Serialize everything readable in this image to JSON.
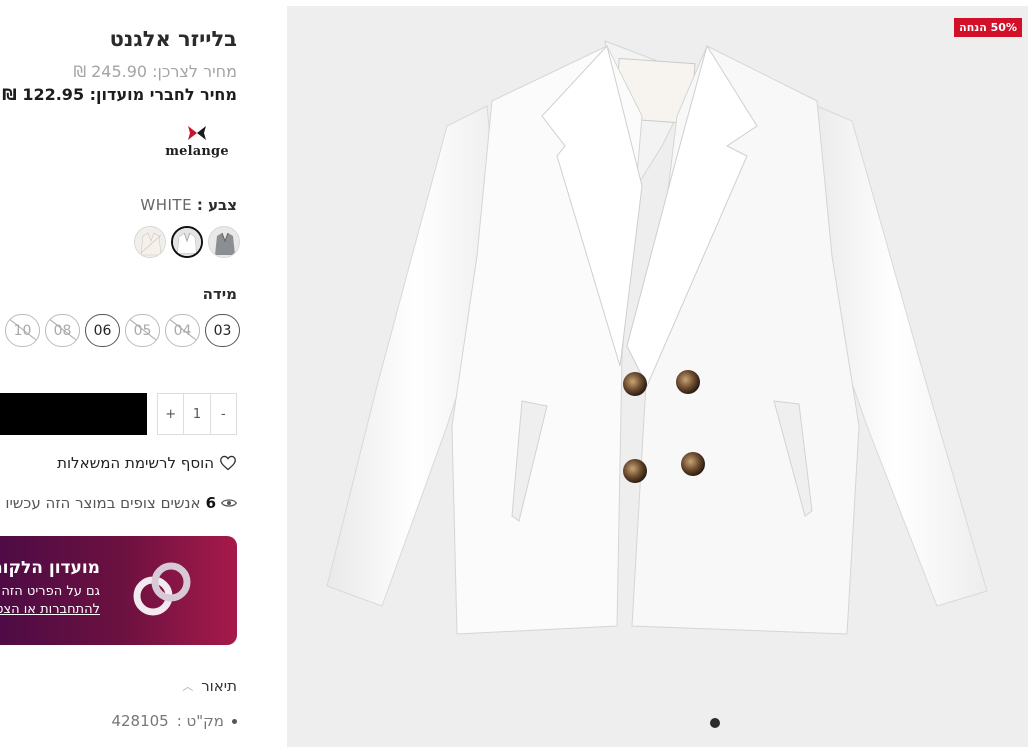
{
  "product": {
    "title": "בלייזר אלגנט",
    "regular_price_label": "מחיר לצרכן:",
    "regular_price": "245.90",
    "club_price_label": "מחיר לחברי מועדון:",
    "club_price": "122.95",
    "currency": "₪",
    "brand": "melange",
    "discount_badge": "50% הנחה"
  },
  "color": {
    "label": "צבע :",
    "value": "WHITE"
  },
  "size": {
    "label": "מידה",
    "options": [
      {
        "label": "03",
        "available": true
      },
      {
        "label": "04",
        "available": false
      },
      {
        "label": "05",
        "available": false
      },
      {
        "label": "06",
        "available": true
      },
      {
        "label": "08",
        "available": false
      },
      {
        "label": "10",
        "available": false
      }
    ]
  },
  "quantity": {
    "minus": "-",
    "value": "1",
    "plus": "+"
  },
  "wishlist": {
    "label": "הוסף לרשימת המשאלות"
  },
  "watchers": {
    "count": "6",
    "text": "אנשים צופים במוצר הזה עכשיו"
  },
  "club_banner": {
    "title": "מועדון הלקוחות",
    "subtitle": "גם על הפריט הזה",
    "link": "להתחברות או הצטרפות"
  },
  "description": {
    "heading": "תיאור",
    "sku_label": "מק\"ט :",
    "sku_value": "428105"
  },
  "colors": {
    "club_gradient_start": "#4a0a46",
    "club_gradient_end": "#a61a4a",
    "badge": "#d3102a",
    "add_to_cart": "#000000"
  }
}
